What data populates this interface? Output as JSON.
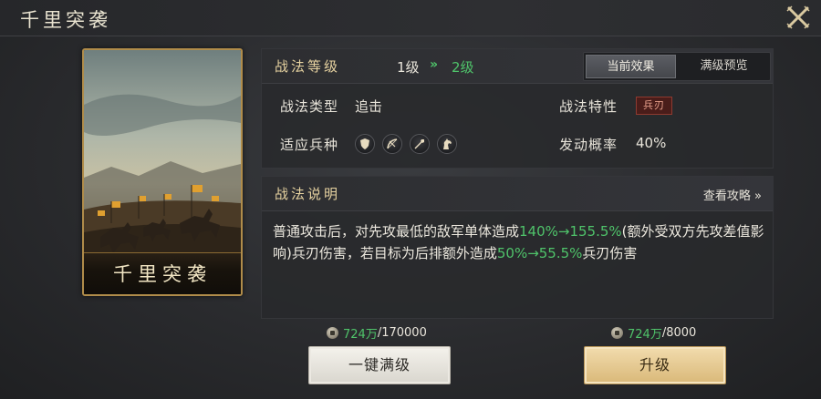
{
  "window": {
    "title": "千里突袭"
  },
  "card": {
    "name": "千里突袭"
  },
  "level_panel": {
    "title": "战法等级",
    "current_level": "1级",
    "arrow": "»",
    "next_level": "2级",
    "tabs": [
      {
        "label": "当前效果",
        "active": true
      },
      {
        "label": "满级预览",
        "active": false
      }
    ],
    "rows": {
      "type_label": "战法类型",
      "type_value": "追击",
      "trait_label": "战法特性",
      "trait_value": "兵刃",
      "units_label": "适应兵种",
      "unit_icons": [
        "shield-icon",
        "bow-icon",
        "spear-icon",
        "horse-icon"
      ],
      "chance_label": "发动概率",
      "chance_value": "40%"
    }
  },
  "desc_panel": {
    "title": "战法说明",
    "guide_link": "查看攻略 »",
    "text_1": "普通攻击后，对先攻最低的敌军单体造成",
    "hl_1": "140%→155.5%",
    "text_2": "(额外受双方先攻差值影响)兵刃伤害，若目标为后排额外造成",
    "hl_2": "50%→55.5%",
    "text_3": "兵刃伤害"
  },
  "costs": {
    "max_have": "724万",
    "max_need": "/170000",
    "up_have": "724万",
    "up_need": "/8000"
  },
  "buttons": {
    "max_label": "一键满级",
    "up_label": "升级"
  },
  "colors": {
    "accent_green": "#4fc36a",
    "gold_border": "#b08c4a",
    "trait_red": "#8e3a30"
  }
}
